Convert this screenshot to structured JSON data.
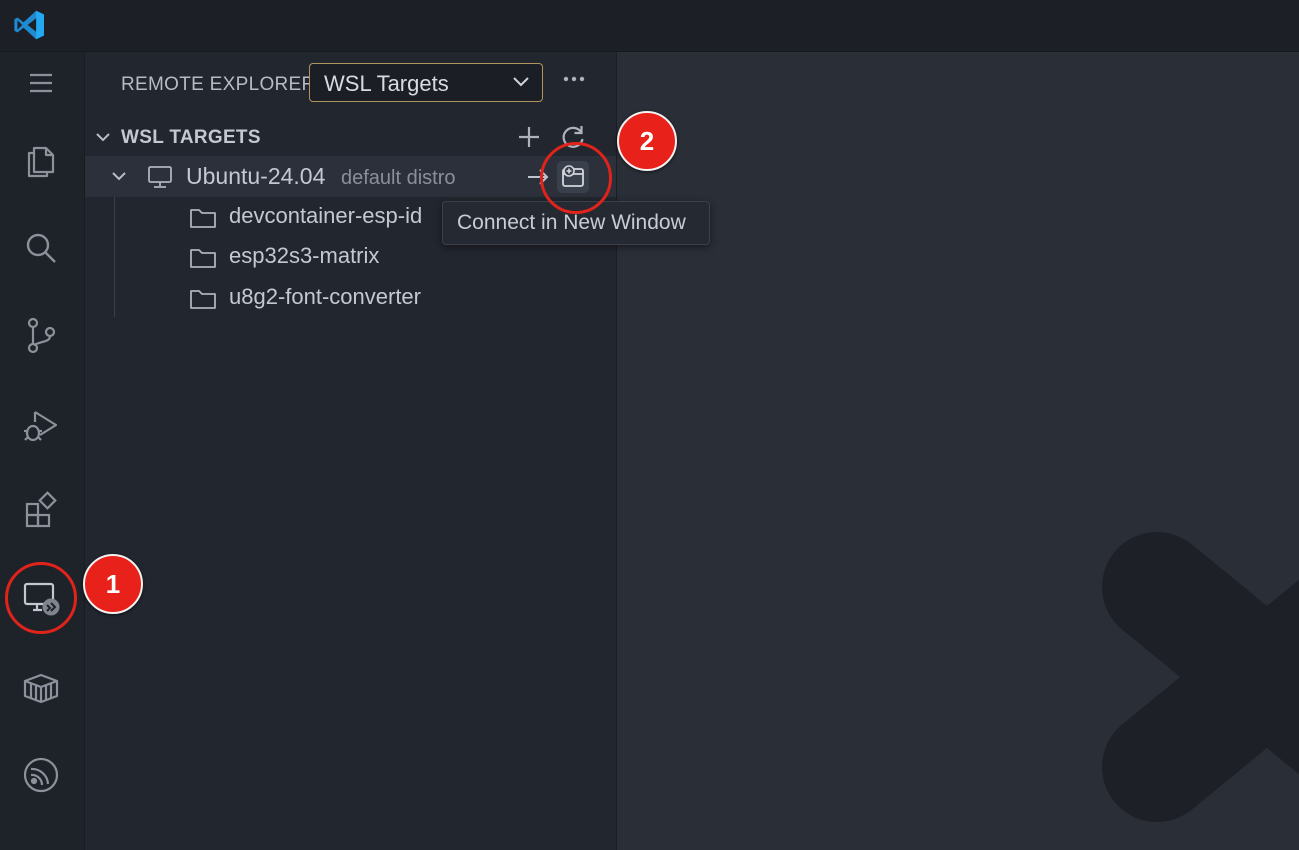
{
  "sidebar": {
    "title": "REMOTE EXPLORER",
    "view_select": {
      "value": "WSL Targets"
    }
  },
  "section": {
    "title": "WSL TARGETS"
  },
  "distro": {
    "name": "Ubuntu-24.04",
    "description": "default distro"
  },
  "folders": [
    {
      "name": "devcontainer-esp-id"
    },
    {
      "name": "esp32s3-matrix"
    },
    {
      "name": "u8g2-font-converter"
    }
  ],
  "tooltip": {
    "text": "Connect in New Window"
  },
  "annotations": [
    {
      "label": "1"
    },
    {
      "label": "2"
    }
  ],
  "activity_items": [
    "menu-icon",
    "explorer-files-icon",
    "search-icon",
    "source-control-icon",
    "run-debug-icon",
    "extensions-icon",
    "remote-explorer-icon",
    "containers-icon",
    "espressif-icon"
  ],
  "colors": {
    "annotation_red": "#e8221a",
    "select_border": "#b0955c",
    "accent_blue": "#23a9f2"
  }
}
